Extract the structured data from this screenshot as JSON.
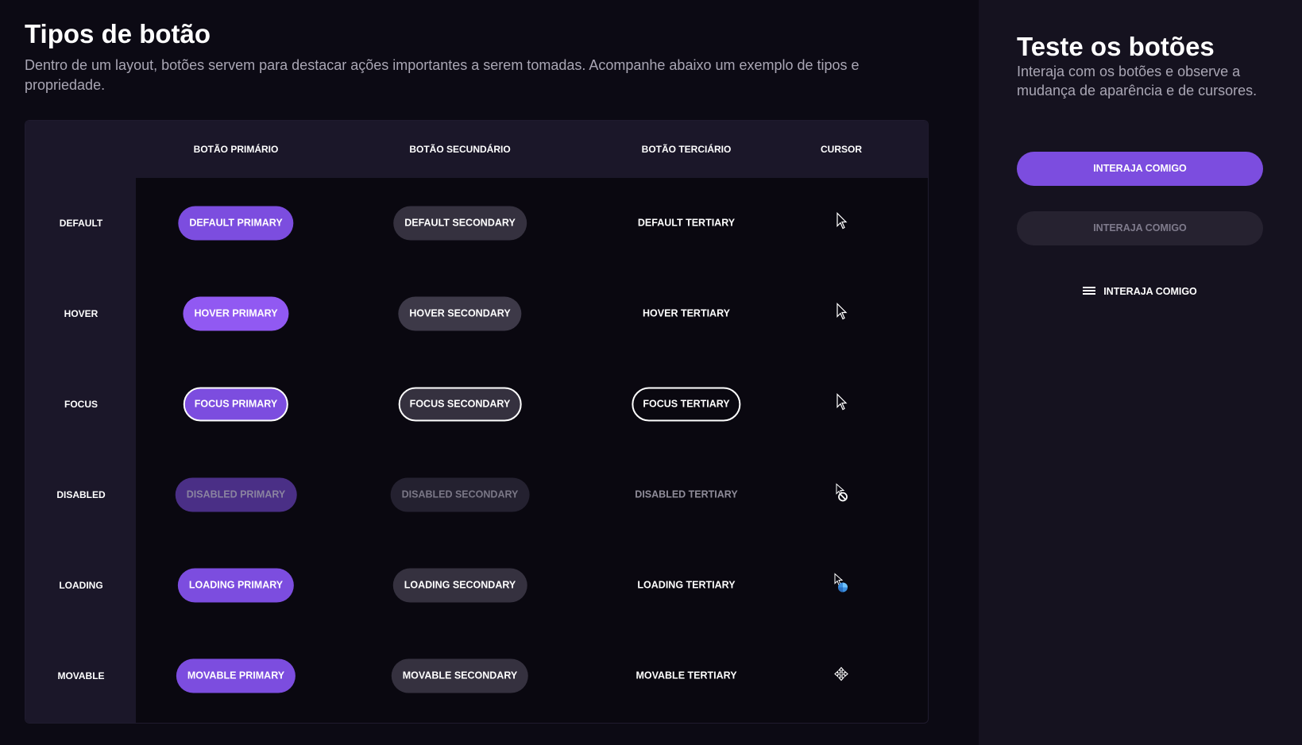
{
  "main": {
    "title": "Tipos de botão",
    "description": "Dentro de um layout, botões servem para destacar ações importantes a serem tomadas. Acompanhe abaixo um exemplo de tipos e propriedade."
  },
  "table": {
    "columns": [
      "BOTÃO PRIMÁRIO",
      "BOTÃO SECUNDÁRIO",
      "BOTÃO TERCIÁRIO",
      "CURSOR"
    ],
    "rows": [
      {
        "label": "DEFAULT",
        "primary": "DEFAULT PRIMARY",
        "secondary": "DEFAULT SECONDARY",
        "tertiary": "DEFAULT TERTIARY",
        "cursor": "pointer-arrow-icon"
      },
      {
        "label": "HOVER",
        "primary": "HOVER PRIMARY",
        "secondary": "HOVER SECONDARY",
        "tertiary": "HOVER TERTIARY",
        "cursor": "pointer-arrow-icon"
      },
      {
        "label": "FOCUS",
        "primary": "FOCUS PRIMARY",
        "secondary": "FOCUS SECONDARY",
        "tertiary": "FOCUS TERTIARY",
        "cursor": "pointer-arrow-icon"
      },
      {
        "label": "DISABLED",
        "primary": "DISABLED PRIMARY",
        "secondary": "DISABLED SECONDARY",
        "tertiary": "DISABLED TERTIARY",
        "cursor": "not-allowed-cursor-icon"
      },
      {
        "label": "LOADING",
        "primary": "LOADING PRIMARY",
        "secondary": "LOADING SECONDARY",
        "tertiary": "LOADING TERTIARY",
        "cursor": "progress-cursor-icon"
      },
      {
        "label": "MOVABLE",
        "primary": "MOVABLE PRIMARY",
        "secondary": "MOVABLE SECONDARY",
        "tertiary": "MOVABLE TERTIARY",
        "cursor": "move-cursor-icon"
      }
    ]
  },
  "side": {
    "title": "Teste os botões",
    "description": "Interaja com os botões e observe a mudança de aparência e de cursores.",
    "primary_label": "INTERAJA COMIGO",
    "secondary_label": "INTERAJA COMIGO",
    "tertiary_label": "INTERAJA COMIGO",
    "tertiary_icon": "menu-icon"
  },
  "colors": {
    "background": "#0c0a14",
    "panel": "#15121f",
    "table_header": "#1b1729",
    "primary": "#7c4ddf",
    "secondary": "#35313f",
    "text_muted": "#a9a6b4"
  }
}
